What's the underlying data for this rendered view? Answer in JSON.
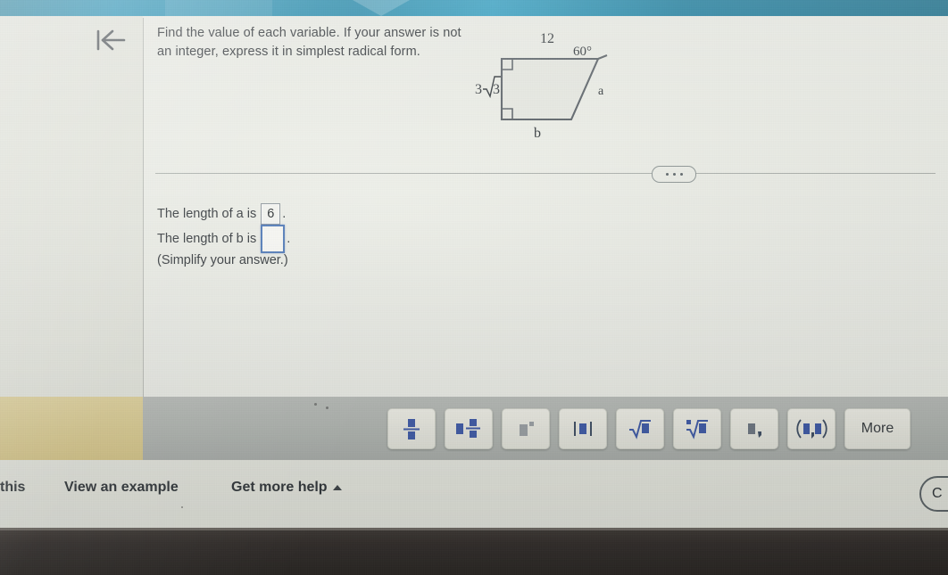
{
  "app": {
    "top_strip_color": "#1f89ac",
    "page_background": "#eef0e9"
  },
  "gutter": {
    "back_icon": "back-to-start-arrow-icon"
  },
  "question": {
    "prompt_line_1": "Find the value of each variable. If your answer is not",
    "prompt_line_2": "an integer, express it in simplest radical form."
  },
  "figure": {
    "name": "right-trapezoid-diagram",
    "labels": {
      "top_side": "12",
      "left_side_coefficient": "3",
      "left_side_radicand": "3",
      "bottom_side": "b",
      "slant_side": "a",
      "angle": "60°"
    },
    "right_angle_markers": 2
  },
  "divider": {
    "ellipsis": "•••"
  },
  "answers": {
    "row_a_label": "The length of a is",
    "row_a_value": "6",
    "row_a_period": ".",
    "row_b_label": "The length of b is",
    "row_b_value": "",
    "row_b_period": ".",
    "simplify_note": "(Simplify your answer.)"
  },
  "palette": {
    "buttons": [
      {
        "name": "fraction-button",
        "glyph": "fraction",
        "label": ""
      },
      {
        "name": "mixed-number-button",
        "glyph": "mixed",
        "label": ""
      },
      {
        "name": "exponent-button",
        "glyph": "exponent",
        "label": ""
      },
      {
        "name": "absolute-value-button",
        "glyph": "abs",
        "label": ""
      },
      {
        "name": "square-root-button",
        "glyph": "sqrt",
        "label": ""
      },
      {
        "name": "nth-root-button",
        "glyph": "nthroot",
        "label": ""
      },
      {
        "name": "comma-list-button",
        "glyph": "comma",
        "label": ""
      },
      {
        "name": "ordered-pair-button",
        "glyph": "pair",
        "label": ""
      },
      {
        "name": "more-button",
        "glyph": "text",
        "label": "More"
      }
    ]
  },
  "help_bar": {
    "link_truncated": "this",
    "link_example": "View an example",
    "link_more_help": "Get more help",
    "right_button_partial": "C"
  }
}
